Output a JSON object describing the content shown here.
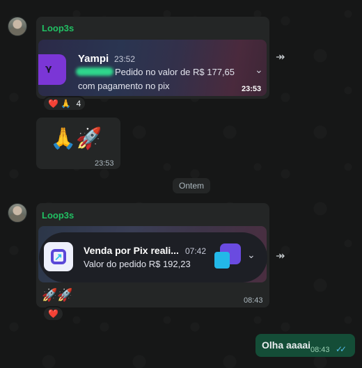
{
  "messages": [
    {
      "sender": "Loop3s",
      "card": {
        "app": "Yampi",
        "app_time": "23:52",
        "line1": "Pedido no valor de R$ 177,65",
        "line2": "com pagamento no pix"
      },
      "time": "23:53",
      "reactions": {
        "emojis": "❤️ 🙏",
        "count": "4"
      }
    },
    {
      "content": "🙏🚀",
      "time": "23:53"
    },
    {
      "sender": "Loop3s",
      "card": {
        "title": "Venda por Pix reali...",
        "time": "07:42",
        "line1": "Valor do pedido R$ 192,23"
      },
      "text": "🚀🚀",
      "time": "08:43",
      "reactions": {
        "emojis": "❤️"
      }
    }
  ],
  "date_divider": "Ontem",
  "outgoing": {
    "text": "Olha aaaai",
    "time": "08:43",
    "status": "read"
  },
  "icons": {
    "forward": "↠",
    "chevron": "⌄",
    "ticks": "✓✓"
  },
  "colors": {
    "sender_green": "#21c063",
    "outgoing_bubble": "#144d37",
    "read_tick": "#53bdeb",
    "yampi_purple": "#7b36d6"
  }
}
